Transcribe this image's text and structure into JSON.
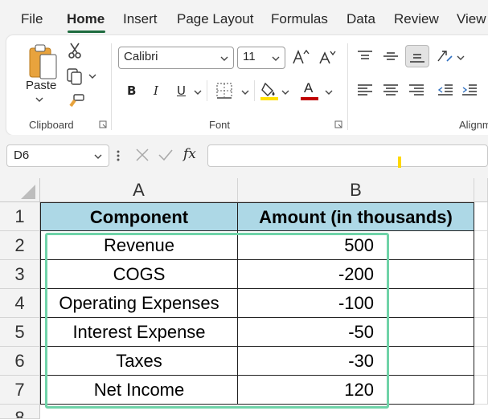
{
  "menu": {
    "tabs": [
      "File",
      "Home",
      "Insert",
      "Page Layout",
      "Formulas",
      "Data",
      "Review",
      "View"
    ],
    "active": "Home"
  },
  "ribbon": {
    "clipboard": {
      "paste_label": "Paste",
      "group_label": "Clipboard"
    },
    "font": {
      "name": "Calibri",
      "size": "11",
      "group_label": "Font",
      "bold": "B",
      "italic": "I",
      "underline": "U",
      "font_color_glyph": "A"
    },
    "alignment": {
      "group_label": "Alignm"
    }
  },
  "formula_bar": {
    "cell_ref": "D6",
    "formula": "",
    "fx_label": "fx"
  },
  "sheet": {
    "columns": [
      "A",
      "B"
    ],
    "row_numbers": [
      "1",
      "2",
      "3",
      "4",
      "5",
      "6",
      "7",
      "8"
    ],
    "header": {
      "a": "Component",
      "b": "Amount (in thousands)"
    },
    "rows": [
      {
        "a": "Revenue",
        "b": "500"
      },
      {
        "a": "COGS",
        "b": "-200"
      },
      {
        "a": "Operating Expenses",
        "b": "-100"
      },
      {
        "a": "Interest Expense",
        "b": "-50"
      },
      {
        "a": "Taxes",
        "b": "-30"
      },
      {
        "a": "Net Income",
        "b": "120"
      }
    ]
  },
  "colors": {
    "header_fill": "#add8e6",
    "highlight_border": "#6fd3a8",
    "active_tab_underline": "#1e6b3e",
    "fill_color_bar": "#ffe000",
    "font_color_bar": "#c00000"
  }
}
